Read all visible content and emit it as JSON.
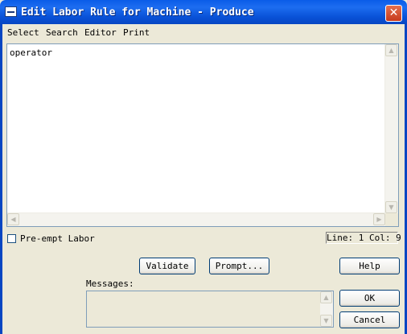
{
  "window": {
    "title": "Edit Labor Rule for Machine - Produce",
    "close_glyph": "✕"
  },
  "menu": {
    "items": [
      "Select",
      "Search",
      "Editor",
      "Print"
    ]
  },
  "editor": {
    "content": "operator"
  },
  "scroll_glyphs": {
    "up": "▲",
    "down": "▼",
    "left": "◀",
    "right": "▶"
  },
  "options": {
    "preempt_label": "Pre-empt Labor",
    "preempt_checked": false
  },
  "status": {
    "line_col": "Line: 1 Col: 9"
  },
  "buttons": {
    "validate": "Validate",
    "prompt": "Prompt...",
    "help": "Help",
    "ok": "OK",
    "cancel": "Cancel"
  },
  "messages": {
    "label": "Messages:",
    "content": ""
  },
  "colors": {
    "title_bar": "#0a5ce8",
    "dialog_bg": "#ece9d8",
    "close_button": "#c73a1c"
  },
  "icons": {
    "window": "app-window-icon",
    "close": "close-icon"
  }
}
